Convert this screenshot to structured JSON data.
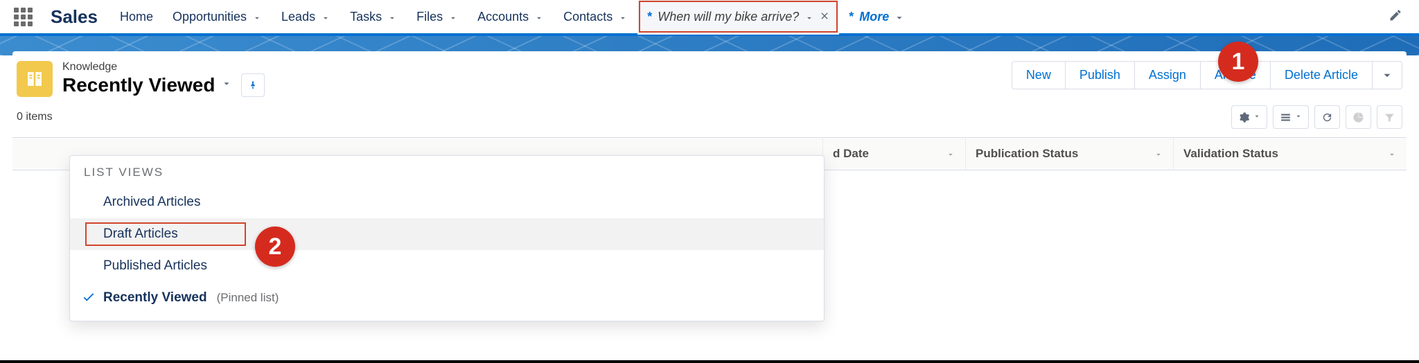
{
  "nav": {
    "app": "Sales",
    "home": "Home",
    "opportunities": "Opportunities",
    "leads": "Leads",
    "tasks": "Tasks",
    "files": "Files",
    "accounts": "Accounts",
    "contacts": "Contacts",
    "active_tab": "When will my bike arrive?",
    "more": "More"
  },
  "callouts": {
    "one": "1",
    "two": "2"
  },
  "header": {
    "object": "Knowledge",
    "listview": "Recently Viewed"
  },
  "actions": {
    "new": "New",
    "publish": "Publish",
    "assign": "Assign",
    "archive": "Archive",
    "delete": "Delete Article"
  },
  "count": "0 items",
  "columns": {
    "date": "d Date",
    "pub": "Publication Status",
    "val": "Validation Status"
  },
  "dropdown": {
    "title": "LIST VIEWS",
    "archived": "Archived Articles",
    "draft": "Draft Articles",
    "published": "Published Articles",
    "recent": "Recently Viewed",
    "pinned": "(Pinned list)"
  }
}
